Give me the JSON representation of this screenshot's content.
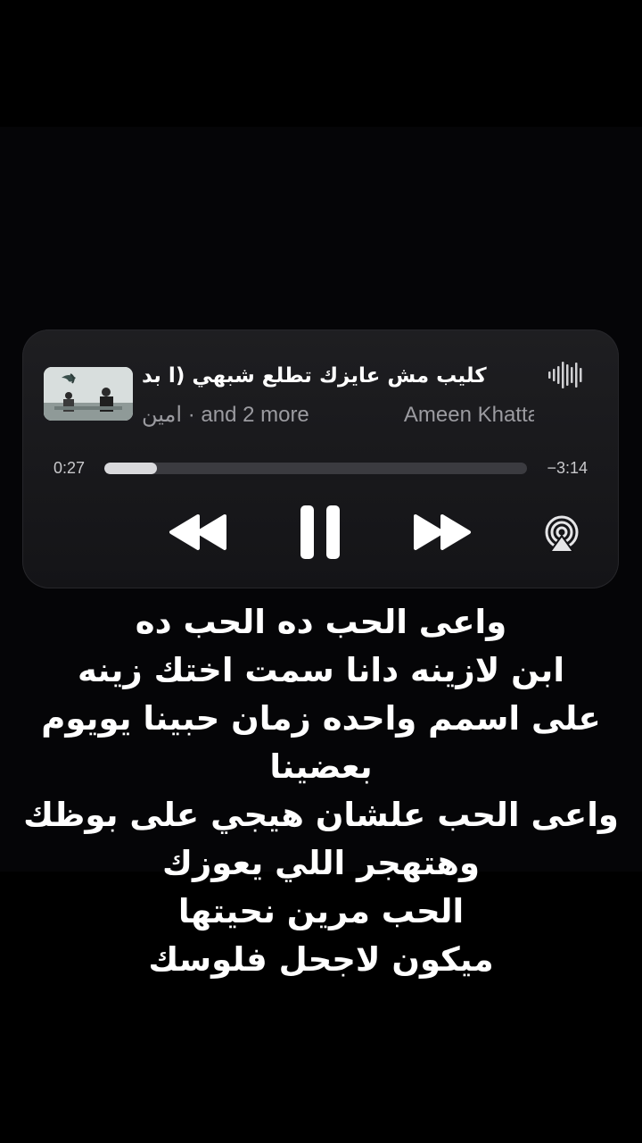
{
  "player": {
    "title": "كليب مش عايزك تطلع شبهي (ا        بد",
    "artist_left": "امين · and 2 more",
    "artist_right": "Ameen Khatta",
    "elapsed": "0:27",
    "remaining": "−3:14",
    "progress": 0.125,
    "icons": {
      "waveform": "waveform-icon",
      "rewind": "rewind-icon",
      "pause": "pause-icon",
      "forward": "fast-forward-icon",
      "airplay": "airplay-icon"
    },
    "accent_color": "#ffffff"
  },
  "lyrics": [
    "واعى الحب ده الحب ده",
    "ابن لازينه دانا سمت اختك زينه",
    "على اسمم واحده زمان حبينا يويوم",
    "بعضينا",
    "واعى الحب علشان هيجي على بوظك",
    "وهتهجر اللي يعوزك",
    "الحب مرين نحيتها",
    "ميكون لاجحل فلوسك"
  ]
}
